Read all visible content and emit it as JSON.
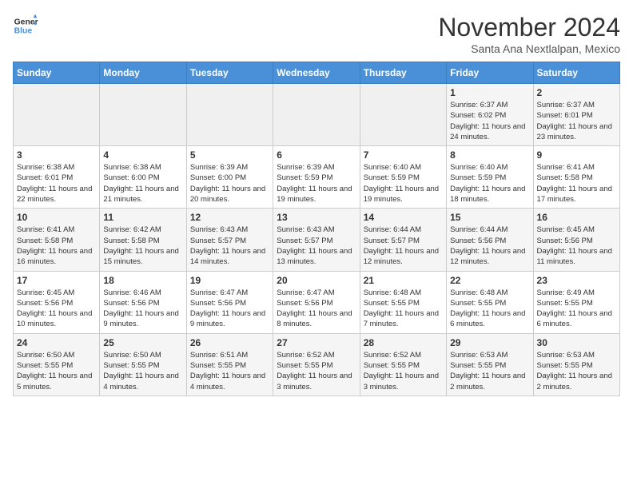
{
  "header": {
    "logo_line1": "General",
    "logo_line2": "Blue",
    "month_title": "November 2024",
    "location": "Santa Ana Nextlalpan, Mexico"
  },
  "days_of_week": [
    "Sunday",
    "Monday",
    "Tuesday",
    "Wednesday",
    "Thursday",
    "Friday",
    "Saturday"
  ],
  "weeks": [
    [
      {
        "day": "",
        "empty": true
      },
      {
        "day": "",
        "empty": true
      },
      {
        "day": "",
        "empty": true
      },
      {
        "day": "",
        "empty": true
      },
      {
        "day": "",
        "empty": true
      },
      {
        "day": "1",
        "sunrise": "Sunrise: 6:37 AM",
        "sunset": "Sunset: 6:02 PM",
        "daylight": "Daylight: 11 hours and 24 minutes."
      },
      {
        "day": "2",
        "sunrise": "Sunrise: 6:37 AM",
        "sunset": "Sunset: 6:01 PM",
        "daylight": "Daylight: 11 hours and 23 minutes."
      }
    ],
    [
      {
        "day": "3",
        "sunrise": "Sunrise: 6:38 AM",
        "sunset": "Sunset: 6:01 PM",
        "daylight": "Daylight: 11 hours and 22 minutes."
      },
      {
        "day": "4",
        "sunrise": "Sunrise: 6:38 AM",
        "sunset": "Sunset: 6:00 PM",
        "daylight": "Daylight: 11 hours and 21 minutes."
      },
      {
        "day": "5",
        "sunrise": "Sunrise: 6:39 AM",
        "sunset": "Sunset: 6:00 PM",
        "daylight": "Daylight: 11 hours and 20 minutes."
      },
      {
        "day": "6",
        "sunrise": "Sunrise: 6:39 AM",
        "sunset": "Sunset: 5:59 PM",
        "daylight": "Daylight: 11 hours and 19 minutes."
      },
      {
        "day": "7",
        "sunrise": "Sunrise: 6:40 AM",
        "sunset": "Sunset: 5:59 PM",
        "daylight": "Daylight: 11 hours and 19 minutes."
      },
      {
        "day": "8",
        "sunrise": "Sunrise: 6:40 AM",
        "sunset": "Sunset: 5:59 PM",
        "daylight": "Daylight: 11 hours and 18 minutes."
      },
      {
        "day": "9",
        "sunrise": "Sunrise: 6:41 AM",
        "sunset": "Sunset: 5:58 PM",
        "daylight": "Daylight: 11 hours and 17 minutes."
      }
    ],
    [
      {
        "day": "10",
        "sunrise": "Sunrise: 6:41 AM",
        "sunset": "Sunset: 5:58 PM",
        "daylight": "Daylight: 11 hours and 16 minutes."
      },
      {
        "day": "11",
        "sunrise": "Sunrise: 6:42 AM",
        "sunset": "Sunset: 5:58 PM",
        "daylight": "Daylight: 11 hours and 15 minutes."
      },
      {
        "day": "12",
        "sunrise": "Sunrise: 6:43 AM",
        "sunset": "Sunset: 5:57 PM",
        "daylight": "Daylight: 11 hours and 14 minutes."
      },
      {
        "day": "13",
        "sunrise": "Sunrise: 6:43 AM",
        "sunset": "Sunset: 5:57 PM",
        "daylight": "Daylight: 11 hours and 13 minutes."
      },
      {
        "day": "14",
        "sunrise": "Sunrise: 6:44 AM",
        "sunset": "Sunset: 5:57 PM",
        "daylight": "Daylight: 11 hours and 12 minutes."
      },
      {
        "day": "15",
        "sunrise": "Sunrise: 6:44 AM",
        "sunset": "Sunset: 5:56 PM",
        "daylight": "Daylight: 11 hours and 12 minutes."
      },
      {
        "day": "16",
        "sunrise": "Sunrise: 6:45 AM",
        "sunset": "Sunset: 5:56 PM",
        "daylight": "Daylight: 11 hours and 11 minutes."
      }
    ],
    [
      {
        "day": "17",
        "sunrise": "Sunrise: 6:45 AM",
        "sunset": "Sunset: 5:56 PM",
        "daylight": "Daylight: 11 hours and 10 minutes."
      },
      {
        "day": "18",
        "sunrise": "Sunrise: 6:46 AM",
        "sunset": "Sunset: 5:56 PM",
        "daylight": "Daylight: 11 hours and 9 minutes."
      },
      {
        "day": "19",
        "sunrise": "Sunrise: 6:47 AM",
        "sunset": "Sunset: 5:56 PM",
        "daylight": "Daylight: 11 hours and 9 minutes."
      },
      {
        "day": "20",
        "sunrise": "Sunrise: 6:47 AM",
        "sunset": "Sunset: 5:56 PM",
        "daylight": "Daylight: 11 hours and 8 minutes."
      },
      {
        "day": "21",
        "sunrise": "Sunrise: 6:48 AM",
        "sunset": "Sunset: 5:55 PM",
        "daylight": "Daylight: 11 hours and 7 minutes."
      },
      {
        "day": "22",
        "sunrise": "Sunrise: 6:48 AM",
        "sunset": "Sunset: 5:55 PM",
        "daylight": "Daylight: 11 hours and 6 minutes."
      },
      {
        "day": "23",
        "sunrise": "Sunrise: 6:49 AM",
        "sunset": "Sunset: 5:55 PM",
        "daylight": "Daylight: 11 hours and 6 minutes."
      }
    ],
    [
      {
        "day": "24",
        "sunrise": "Sunrise: 6:50 AM",
        "sunset": "Sunset: 5:55 PM",
        "daylight": "Daylight: 11 hours and 5 minutes."
      },
      {
        "day": "25",
        "sunrise": "Sunrise: 6:50 AM",
        "sunset": "Sunset: 5:55 PM",
        "daylight": "Daylight: 11 hours and 4 minutes."
      },
      {
        "day": "26",
        "sunrise": "Sunrise: 6:51 AM",
        "sunset": "Sunset: 5:55 PM",
        "daylight": "Daylight: 11 hours and 4 minutes."
      },
      {
        "day": "27",
        "sunrise": "Sunrise: 6:52 AM",
        "sunset": "Sunset: 5:55 PM",
        "daylight": "Daylight: 11 hours and 3 minutes."
      },
      {
        "day": "28",
        "sunrise": "Sunrise: 6:52 AM",
        "sunset": "Sunset: 5:55 PM",
        "daylight": "Daylight: 11 hours and 3 minutes."
      },
      {
        "day": "29",
        "sunrise": "Sunrise: 6:53 AM",
        "sunset": "Sunset: 5:55 PM",
        "daylight": "Daylight: 11 hours and 2 minutes."
      },
      {
        "day": "30",
        "sunrise": "Sunrise: 6:53 AM",
        "sunset": "Sunset: 5:55 PM",
        "daylight": "Daylight: 11 hours and 2 minutes."
      }
    ]
  ]
}
